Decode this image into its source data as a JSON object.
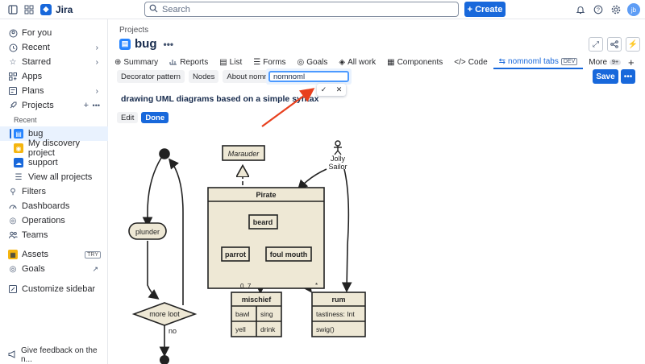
{
  "topbar": {
    "app_name": "Jira",
    "search_placeholder": "Search",
    "create_label": "Create",
    "avatar_initials": "jb"
  },
  "sidebar": {
    "for_you": "For you",
    "recent": "Recent",
    "starred": "Starred",
    "apps": "Apps",
    "plans": "Plans",
    "projects": "Projects",
    "recent_section": "Recent",
    "project_items": [
      "bug",
      "My discovery project",
      "support"
    ],
    "view_all": "View all projects",
    "filters": "Filters",
    "dashboards": "Dashboards",
    "operations": "Operations",
    "teams": "Teams",
    "assets": "Assets",
    "assets_badge": "TRY",
    "goals": "Goals",
    "customize": "Customize sidebar",
    "feedback": "Give feedback on the n..."
  },
  "header": {
    "breadcrumb": "Projects",
    "title": "bug"
  },
  "tabs": [
    {
      "label": "Summary"
    },
    {
      "label": "Reports"
    },
    {
      "label": "List"
    },
    {
      "label": "Forms"
    },
    {
      "label": "Goals"
    },
    {
      "label": "All work"
    },
    {
      "label": "Components"
    },
    {
      "label": "Code"
    },
    {
      "label": "nomnoml tabs",
      "badge": "DEV"
    },
    {
      "label": "More",
      "badge": "9+"
    }
  ],
  "page_tabs": [
    "Decorator pattern",
    "Nodes",
    "About nomnoml"
  ],
  "edit_field": {
    "value": "nomnoml"
  },
  "save_label": "Save",
  "content": {
    "heading": "drawing UML diagrams based on a simple syntax",
    "edit_label": "Edit",
    "done_label": "Done"
  },
  "diagram": {
    "marauder": "Marauder",
    "jolly": "Jolly",
    "sailor": "Sailor",
    "pirate": "Pirate",
    "beard": "beard",
    "parrot": "parrot",
    "foul_mouth": "foul mouth",
    "plunder": "plunder",
    "more_loot": "more loot",
    "no": "no",
    "mult_left": "0..7",
    "mult_right": "*",
    "mischief": "mischief",
    "bawl": "bawl",
    "sing": "sing",
    "yell": "yell",
    "drink": "drink",
    "rum": "rum",
    "tastiness": "tastiness: Int",
    "swig": "swig()"
  },
  "colors": {
    "accent": "#1868db",
    "node_fill": "#eee8d5",
    "annotation": "#e8401e"
  }
}
